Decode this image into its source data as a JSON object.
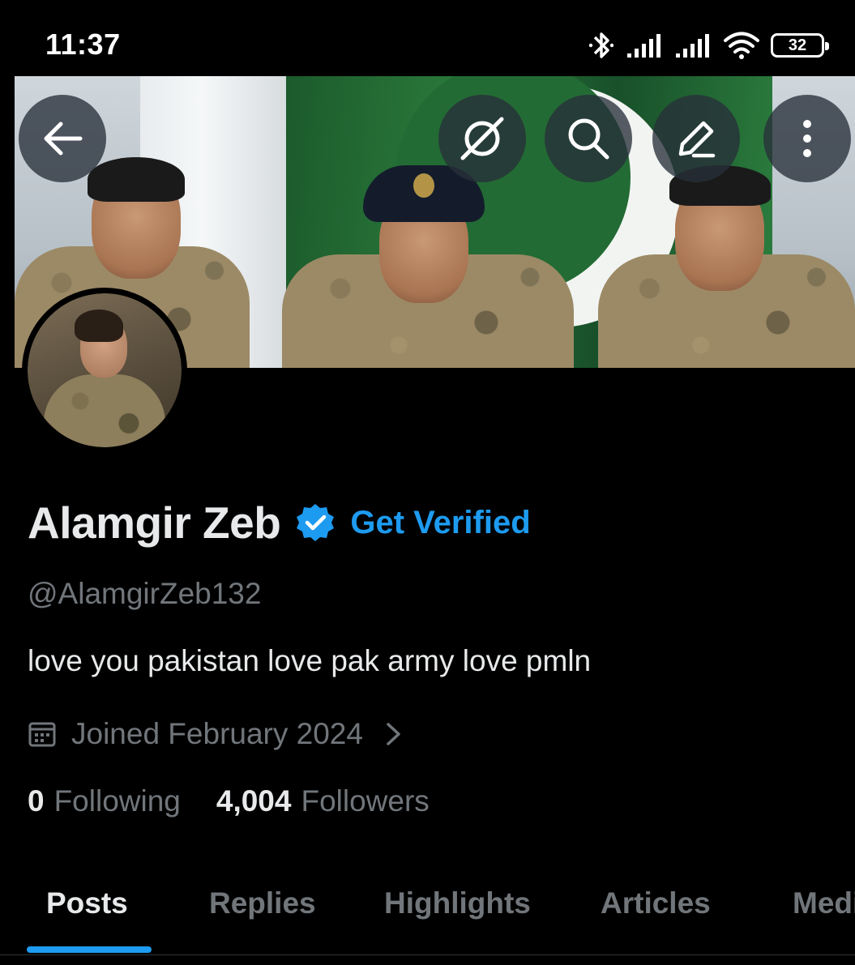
{
  "status_bar": {
    "time": "11:37",
    "battery": "32",
    "icons": [
      "bluetooth-icon",
      "signal-icon",
      "signal-icon",
      "wifi-icon",
      "battery-icon"
    ]
  },
  "banner_actions": {
    "back": "arrow-left-icon",
    "grok": "grok-icon",
    "search": "search-icon",
    "edit": "pencil-icon",
    "more": "more-vertical-icon"
  },
  "profile": {
    "display_name": "Alamgir Zeb",
    "get_verified": "Get Verified",
    "handle": "@AlamgirZeb132",
    "bio": "love you pakistan love pak army love pmln",
    "joined": "Joined February 2024",
    "following_count": "0",
    "following_label": "Following",
    "followers_count": "4,004",
    "followers_label": "Followers"
  },
  "tabs": [
    {
      "label": "Posts",
      "active": true
    },
    {
      "label": "Replies",
      "active": false
    },
    {
      "label": "Highlights",
      "active": false
    },
    {
      "label": "Articles",
      "active": false
    },
    {
      "label": "Media",
      "active": false
    }
  ],
  "colors": {
    "background": "#000000",
    "accent": "#1d9bf0",
    "text_primary": "#e7e9ea",
    "text_secondary": "#71767b"
  }
}
